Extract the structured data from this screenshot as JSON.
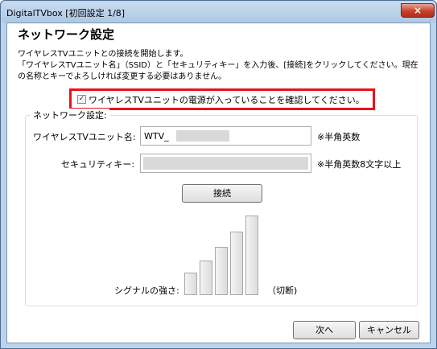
{
  "window": {
    "title": "DigitalTVbox [初回設定 1/8]",
    "close_label": "×"
  },
  "page": {
    "heading": "ネットワーク設定",
    "intro_lines": [
      "ワイヤレスTVユニットとの接続を開始します。",
      "「ワイヤレスTVユニット名」（SSID）と「セキュリティキー」を入力後、[接続]をクリックしてください。現在",
      "の名称とキーでよろしければ変更する必要はありません。"
    ]
  },
  "power_check": {
    "checked": true,
    "check_mark": "✓",
    "label": "ワイヤレスTVユニットの電源が入っていることを確認してください。",
    "highlight_color": "#e6121a"
  },
  "network": {
    "group_label": "ネットワーク設定:",
    "ssid_label": "ワイヤレスTVユニット名:",
    "ssid_value": "WTV_",
    "ssid_note": "※半角英数",
    "key_label": "セキュリティキー:",
    "key_note": "※半角英数8文字以上",
    "connect_label": "接続"
  },
  "signal": {
    "label": "シグナルの強さ:",
    "status": "（切断)",
    "bars_total": 5
  },
  "footer": {
    "next_label": "次へ",
    "cancel_label": "キャンセル"
  }
}
